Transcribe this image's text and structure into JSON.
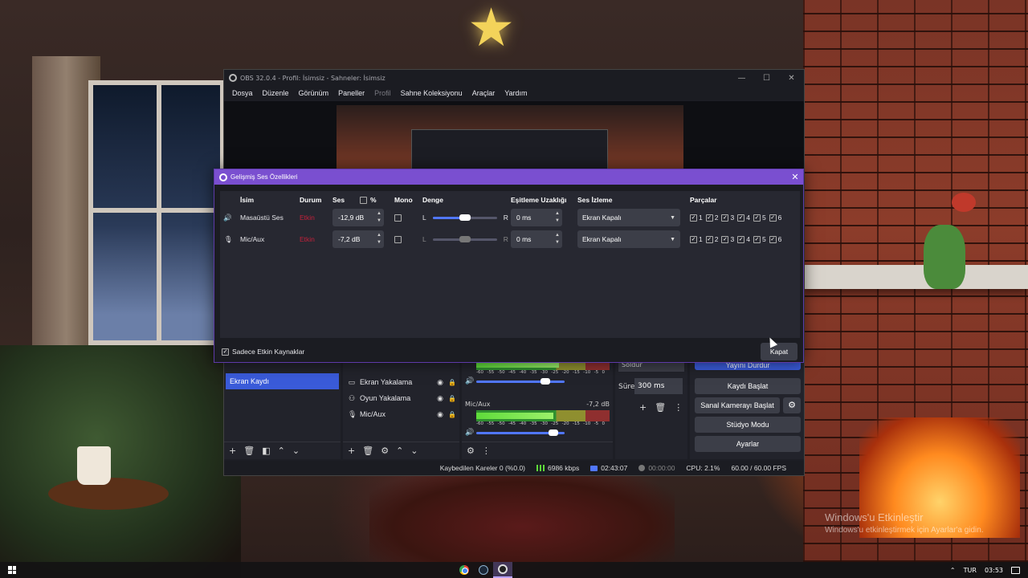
{
  "obs_window": {
    "title": "OBS 32.0.4 - Profil: İsimsiz - Sahneler: İsimsiz",
    "menu": [
      "Dosya",
      "Düzenle",
      "Görünüm",
      "Paneller",
      "Profil",
      "Sahne Koleksiyonu",
      "Araçlar",
      "Yardım"
    ]
  },
  "dialog": {
    "title": "Gelişmiş Ses Özellikleri",
    "headers": {
      "name": "İsim",
      "status": "Durum",
      "volume": "Ses",
      "percent": "%",
      "mono": "Mono",
      "balance": "Denge",
      "sync_offset": "Eşitleme Uzaklığı",
      "monitoring": "Ses İzleme",
      "tracks": "Parçalar"
    },
    "rows": [
      {
        "icon": "speaker-icon",
        "name": "Masaüstü Ses",
        "status": "Etkin",
        "volume": "-12,9 dB",
        "mono": false,
        "balance_left": "L",
        "balance_right": "R",
        "balance_value": 0.5,
        "sync_offset": "0 ms",
        "monitoring": "Ekran Kapalı",
        "tracks": [
          "1",
          "2",
          "3",
          "4",
          "5",
          "6"
        ]
      },
      {
        "icon": "microphone-icon",
        "name": "Mic/Aux",
        "status": "Etkin",
        "volume": "-7,2 dB",
        "mono": false,
        "balance_left": "L",
        "balance_right": "R",
        "balance_value": 0.5,
        "sync_offset": "0 ms",
        "monitoring": "Ekran Kapalı",
        "tracks": [
          "1",
          "2",
          "3",
          "4",
          "5",
          "6"
        ]
      }
    ],
    "active_only_label": "Sadece Etkin Kaynaklar",
    "active_only_checked": true,
    "close_label": "Kapat"
  },
  "scenes": {
    "selected": "Ekran Kaydı"
  },
  "sources": {
    "items": [
      {
        "icon": "monitor-icon",
        "label": "Ekran Yakalama"
      },
      {
        "icon": "gamepad-icon",
        "label": "Oyun Yakalama"
      },
      {
        "icon": "microphone-icon",
        "label": "Mic/Aux"
      }
    ]
  },
  "mixer": {
    "scale": [
      "-60",
      "-55",
      "-50",
      "-45",
      "-40",
      "-35",
      "-30",
      "-25",
      "-20",
      "-15",
      "-10",
      "-5",
      "0"
    ],
    "channels": [
      {
        "name": "",
        "db": "",
        "level": 0.62,
        "volume": 0.78
      },
      {
        "name": "Mic/Aux",
        "db": "-7,2 dB",
        "level": 0.58,
        "volume": 0.87
      }
    ]
  },
  "transitions": {
    "selected": "Soldur",
    "duration_label": "Süre",
    "duration": "300 ms"
  },
  "controls": {
    "stop_stream": "Yayını Durdur",
    "start_recording": "Kaydı Başlat",
    "start_virtual_camera": "Sanal Kamerayı Başlat",
    "studio_mode": "Stüdyo Modu",
    "settings": "Ayarlar"
  },
  "statusbar": {
    "dropped_frames": "Kaybedilen Kareler 0 (%0.0)",
    "bitrate": "6986 kbps",
    "stream_time": "02:43:07",
    "record_time": "00:00:00",
    "cpu": "CPU: 2.1%",
    "fps": "60.00 / 60.00 FPS"
  },
  "desktop": {
    "watermark_title": "Windows'u Etkinleştir",
    "watermark_sub": "Windows'u etkinleştirmek için Ayarlar'a gidin.",
    "tray_lang": "TUR",
    "tray_time": "03:53",
    "taskbar_apps": [
      "chrome-icon",
      "steam-icon",
      "obs-icon"
    ]
  },
  "colors": {
    "accent": "#7a4fd0",
    "selection": "#3a5bd9",
    "status_active": "#c2203a",
    "slider": "#5177ff"
  }
}
